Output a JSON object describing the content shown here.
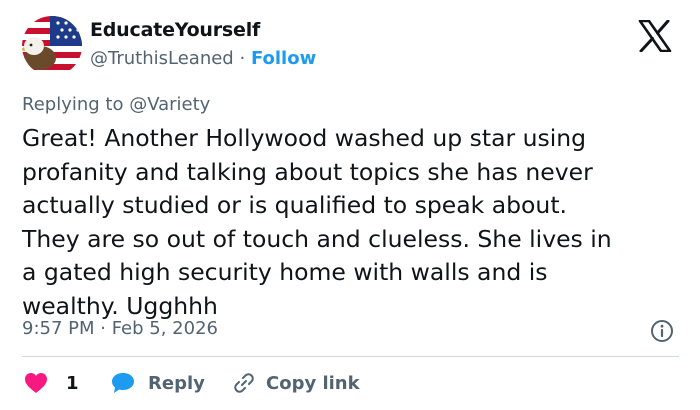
{
  "author": {
    "name": "EducateYourself",
    "handle": "@TruthisLeaned",
    "separator": "·",
    "follow_label": "Follow"
  },
  "reply_context": {
    "prefix": "Replying to ",
    "mention": "@Variety"
  },
  "tweet": {
    "text": "Great! Another Hollywood washed up star using\nprofanity and talking about topics she has never\nactually studied or is qualified to speak about.\nThey are so out of touch and clueless.  She lives in\na gated high security home with walls and is\nwealthy.  Ugghhh",
    "timestamp": "9:57 PM · Feb 5, 2026"
  },
  "actions": {
    "like_count": "1",
    "reply_label": "Reply",
    "copy_link_label": "Copy link"
  },
  "colors": {
    "accent": "#1d9bf0",
    "like": "#f91880",
    "muted": "#536471",
    "divider": "#cfd9de"
  },
  "icons": [
    "avatar-flag-eagle",
    "x-logo-icon",
    "info-icon",
    "heart-icon",
    "reply-bubble-icon",
    "link-icon"
  ]
}
